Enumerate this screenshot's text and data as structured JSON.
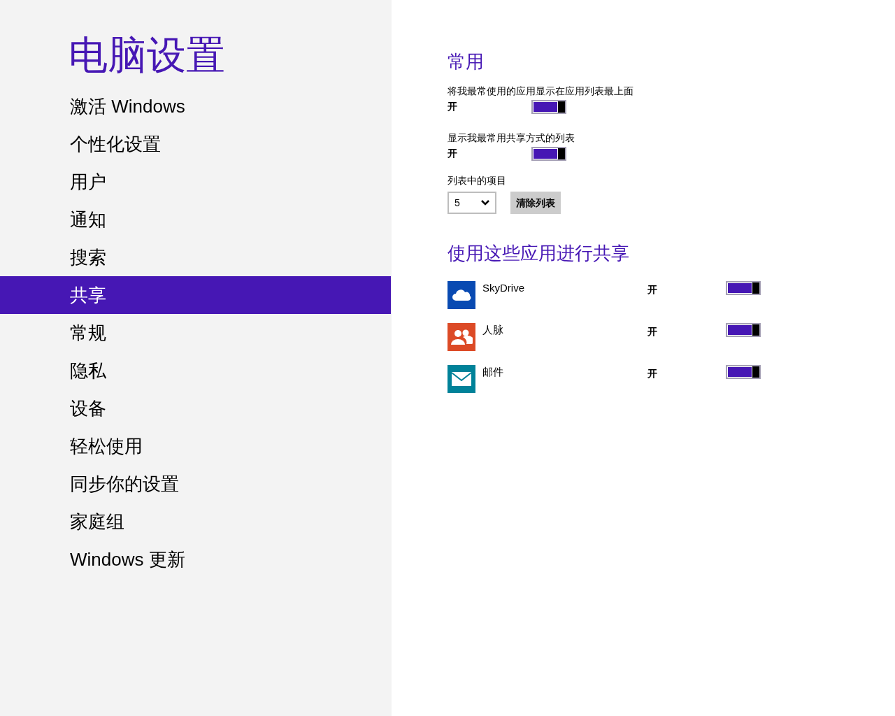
{
  "title": "电脑设置",
  "nav": [
    {
      "label": "激活 Windows",
      "selected": false
    },
    {
      "label": "个性化设置",
      "selected": false
    },
    {
      "label": "用户",
      "selected": false
    },
    {
      "label": "通知",
      "selected": false
    },
    {
      "label": "搜索",
      "selected": false
    },
    {
      "label": "共享",
      "selected": true
    },
    {
      "label": "常规",
      "selected": false
    },
    {
      "label": "隐私",
      "selected": false
    },
    {
      "label": "设备",
      "selected": false
    },
    {
      "label": "轻松使用",
      "selected": false
    },
    {
      "label": "同步你的设置",
      "selected": false
    },
    {
      "label": "家庭组",
      "selected": false
    },
    {
      "label": "Windows 更新",
      "selected": false
    }
  ],
  "general": {
    "heading": "常用",
    "settings": [
      {
        "label": "将我最常使用的应用显示在应用列表最上面",
        "state": "开",
        "on": true
      },
      {
        "label": "显示我最常用共享方式的列表",
        "state": "开",
        "on": true
      }
    ],
    "items_label": "列表中的项目",
    "items_value": "5",
    "clear_button": "清除列表"
  },
  "share": {
    "heading": "使用这些应用进行共享",
    "apps": [
      {
        "name": "SkyDrive",
        "kind": "cloud",
        "color": "#094ab2",
        "state": "开",
        "on": true
      },
      {
        "name": "人脉",
        "kind": "people",
        "color": "#dc4a26",
        "state": "开",
        "on": true
      },
      {
        "name": "邮件",
        "kind": "mail",
        "color": "#008299",
        "state": "开",
        "on": true
      }
    ]
  }
}
